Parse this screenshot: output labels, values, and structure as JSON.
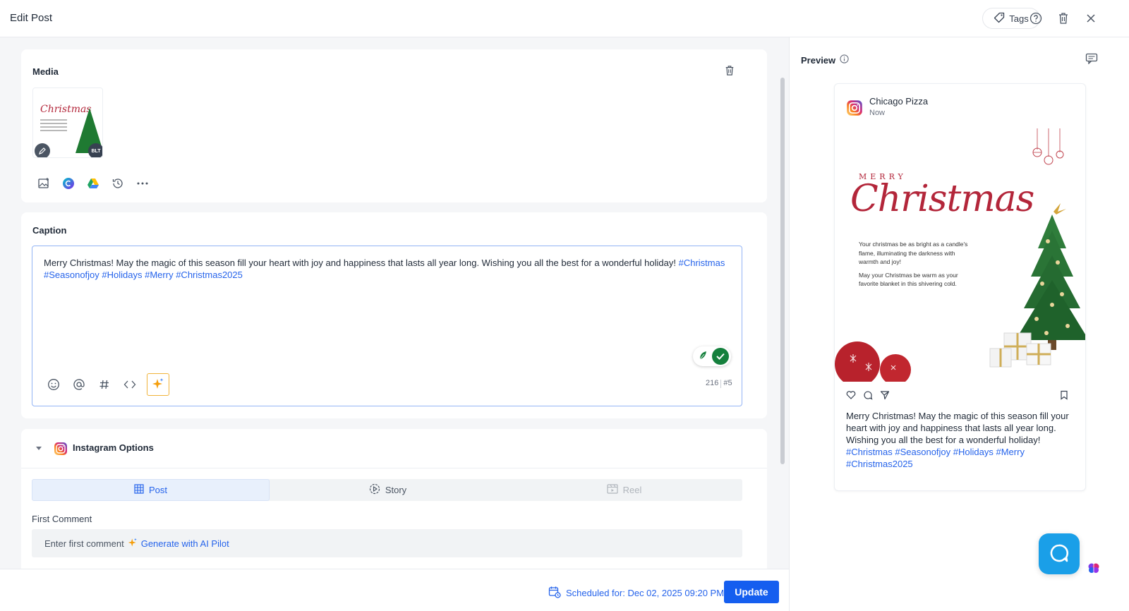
{
  "header": {
    "title": "Edit Post",
    "tags_label": "Tags"
  },
  "media": {
    "title": "Media",
    "thumbnail_badge": "BLT",
    "thumbnail_title": "Christmas"
  },
  "caption": {
    "title": "Caption",
    "text_plain": "Merry Christmas! May the magic of this season fill your heart with joy and happiness that lasts all year long. Wishing you all the best for a wonderful holiday!",
    "hashtags": [
      "#Christmas",
      "#Seasonofjoy",
      "#Holidays",
      "#Merry",
      "#Christmas2025"
    ],
    "char_count": "216",
    "hashtag_count": "#5"
  },
  "instagram_options": {
    "title": "Instagram Options",
    "tabs": [
      {
        "label": "Post",
        "state": "active"
      },
      {
        "label": "Story",
        "state": "normal"
      },
      {
        "label": "Reel",
        "state": "disabled"
      }
    ],
    "first_comment_label": "First Comment",
    "first_comment_placeholder": "Enter first comment",
    "generate_label": "Generate with AI Pilot"
  },
  "footer": {
    "scheduled_text": "Scheduled for: Dec 02, 2025 09:20 PM",
    "update_label": "Update"
  },
  "preview": {
    "title": "Preview",
    "account_name": "Chicago Pizza",
    "post_time": "Now",
    "image": {
      "merry": "MERRY",
      "christmas": "Christmas",
      "paragraph_1": "Your christmas be as bright as a candle's flame, illuminating the darkness with warmth and joy!",
      "paragraph_2": "May your Christmas be warm as your favorite blanket in this shivering cold."
    },
    "caption_plain": "Merry Christmas! May the magic of this season fill your heart with joy and happiness that lasts all year long. Wishing you all the best for a wonderful holiday!",
    "hashtags": [
      "#Christmas",
      "#Seasonofjoy",
      "#Holidays",
      "#Merry",
      "#Christmas2025"
    ]
  },
  "colors": {
    "accent": "#155eef",
    "link": "#2563eb",
    "christmas_red": "#b3263a",
    "grammar_green": "#15803d",
    "chat_blue": "#1a9fe8"
  },
  "icons": {
    "header": [
      "tag-icon",
      "help-icon",
      "trash-icon",
      "close-icon"
    ],
    "media_tools": [
      "image-upload-icon",
      "canva-icon",
      "google-drive-icon",
      "history-icon",
      "more-icon"
    ],
    "caption_tools": [
      "emoji-icon",
      "mention-icon",
      "hashtag-icon",
      "code-icon",
      "ai-sparkle-icon"
    ],
    "preview_actions": [
      "heart-icon",
      "comment-icon",
      "share-icon",
      "bookmark-icon"
    ]
  }
}
